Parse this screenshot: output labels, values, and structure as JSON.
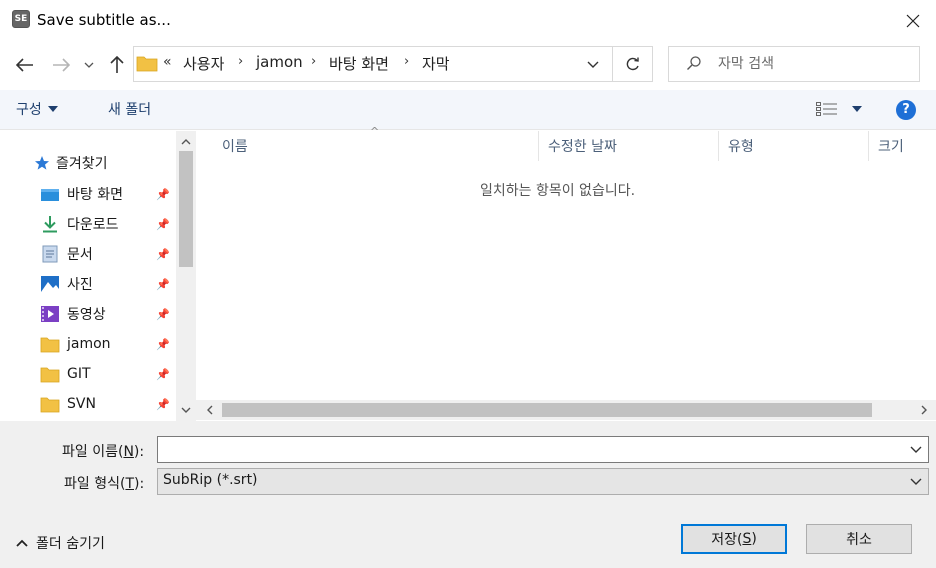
{
  "window": {
    "title": "Save subtitle as...",
    "app_icon_text": "SE"
  },
  "address": {
    "overflow": "«",
    "crumbs": [
      "사용자",
      "jamon",
      "바탕 화면",
      "자막"
    ],
    "separator": "›"
  },
  "search": {
    "placeholder": "자막 검색"
  },
  "toolbar": {
    "organize_label": "구성",
    "new_folder_label": "새 폴더"
  },
  "nav": {
    "quick_access": "즐겨찾기",
    "items": [
      {
        "label": "바탕 화면",
        "icon": "desktop-icon"
      },
      {
        "label": "다운로드",
        "icon": "download-icon"
      },
      {
        "label": "문서",
        "icon": "documents-icon"
      },
      {
        "label": "사진",
        "icon": "pictures-icon"
      },
      {
        "label": "동영상",
        "icon": "videos-icon"
      },
      {
        "label": "jamon",
        "icon": "folder-icon"
      },
      {
        "label": "GIT",
        "icon": "folder-icon"
      },
      {
        "label": "SVN",
        "icon": "folder-icon"
      }
    ]
  },
  "file_list": {
    "columns": [
      "이름",
      "수정한 날짜",
      "유형",
      "크기"
    ],
    "empty_message": "일치하는 항목이 없습니다."
  },
  "form": {
    "filename_label_prefix": "파일 이름(",
    "filename_label_key": "N",
    "filename_label_suffix": "):",
    "filename_value": "",
    "filetype_label_prefix": "파일 형식(",
    "filetype_label_key": "T",
    "filetype_label_suffix": "):",
    "filetype_value": "SubRip (*.srt)"
  },
  "footer": {
    "hide_folders": "폴더 숨기기",
    "save_prefix": "저장(",
    "save_key": "S",
    "save_suffix": ")",
    "cancel": "취소"
  },
  "colors": {
    "accent": "#0078d7",
    "toolbar_bg": "#f3f6fb",
    "bottom_bg": "#f0f0f0",
    "help": "#1e6fd6",
    "folder": "#f2c144"
  }
}
